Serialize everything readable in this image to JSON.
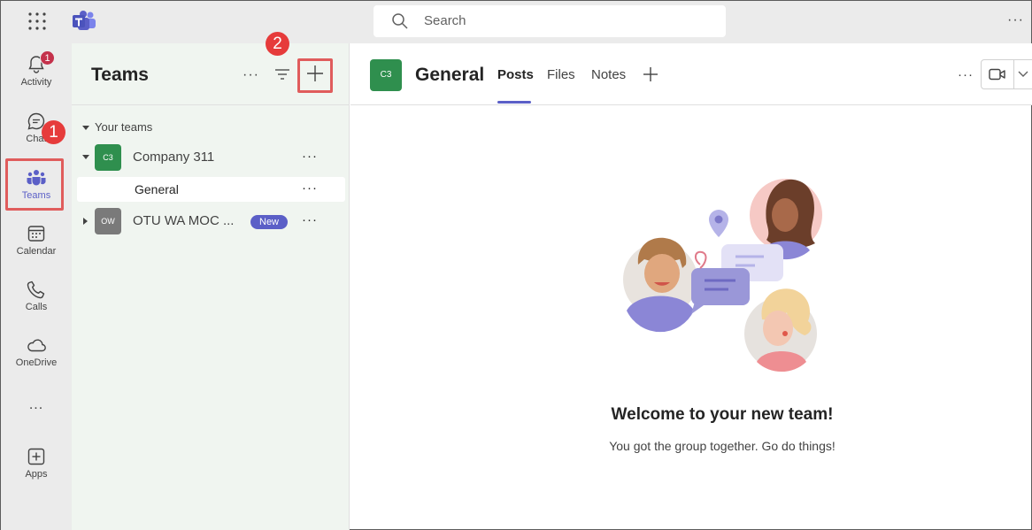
{
  "search": {
    "placeholder": "Search"
  },
  "rail": {
    "items": [
      {
        "label": "Activity",
        "icon": "bell-icon",
        "badge": "1"
      },
      {
        "label": "Chat",
        "icon": "chat-icon"
      },
      {
        "label": "Teams",
        "icon": "teams-icon"
      },
      {
        "label": "Calendar",
        "icon": "calendar-icon"
      },
      {
        "label": "Calls",
        "icon": "phone-icon"
      },
      {
        "label": "OneDrive",
        "icon": "cloud-icon"
      },
      {
        "label": "...",
        "icon": "more-icon"
      },
      {
        "label": "Apps",
        "icon": "add-app-icon"
      }
    ]
  },
  "callouts": {
    "one": "1",
    "two": "2"
  },
  "teams_pane": {
    "title": "Teams",
    "more": "···",
    "section": "Your teams",
    "teams": [
      {
        "initials": "C3",
        "name": "Company 311",
        "color": "#2f8f4e",
        "channels": [
          {
            "name": "General"
          }
        ]
      },
      {
        "initials": "OW",
        "name": "OTU WA MOC ...",
        "color": "#7a7a7a",
        "badge": "New"
      }
    ]
  },
  "channel": {
    "initials": "C3",
    "title": "General",
    "tabs": [
      "Posts",
      "Files",
      "Notes"
    ],
    "active_tab": "Posts"
  },
  "welcome": {
    "title": "Welcome to your new team!",
    "subtitle": "You got the group together. Go do things!"
  },
  "colors": {
    "accent": "#5b5fc7",
    "highlight": "#e05c5c",
    "callout": "#e63b3b",
    "team_green": "#2f8f4e"
  }
}
